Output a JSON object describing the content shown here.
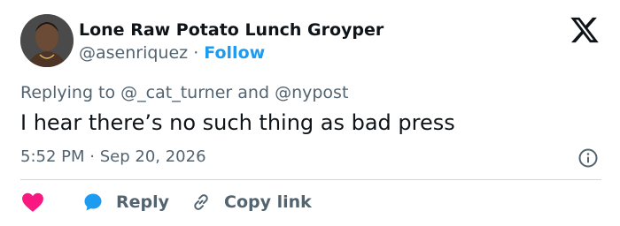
{
  "tweet": {
    "author_name": "Lone Raw Potato Lunch Groyper",
    "author_handle": "@asenriquez",
    "separator": "·",
    "follow_label": "Follow",
    "replying_prefix": "Replying to",
    "reply_to_1": "@_cat_turner",
    "replying_and": "and",
    "reply_to_2": "@nypost",
    "text": "I hear there’s no such thing as bad press",
    "time": "5:52 PM",
    "date": "Sep 20, 2026"
  },
  "actions": {
    "reply_label": "Reply",
    "copy_label": "Copy link"
  },
  "icons": {
    "logo": "x-logo-icon",
    "info": "info-icon",
    "like": "heart-icon",
    "reply": "speech-bubble-icon",
    "copy": "link-icon"
  },
  "colors": {
    "text_primary": "#0f1419",
    "text_secondary": "#536471",
    "accent": "#1d9bf0",
    "like": "#f91880",
    "divider": "#cfd9de"
  }
}
